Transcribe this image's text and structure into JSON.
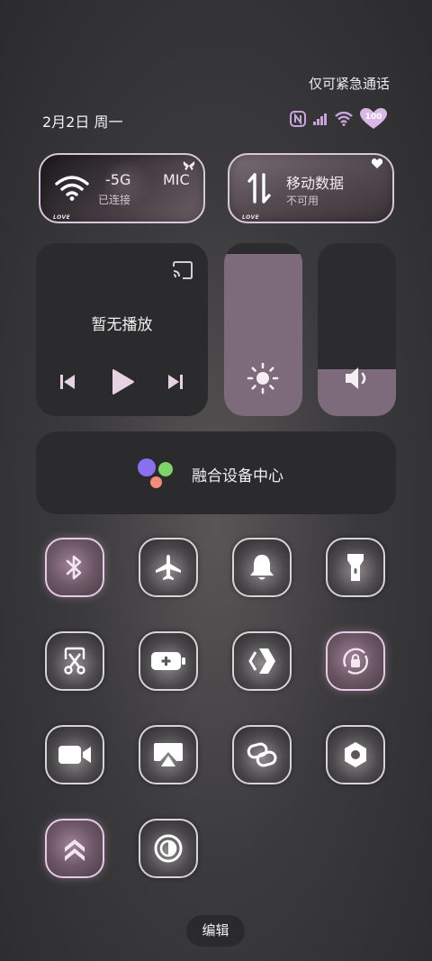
{
  "status": {
    "emergency_text": "仅可紧急通话",
    "date": "2月2日 周一",
    "battery_level": "100"
  },
  "wifi_card": {
    "network_name": "-5G",
    "overlay_text": "MIC",
    "status": "已连接",
    "sticker": "LOVE"
  },
  "mobile_data_card": {
    "title": "移动数据",
    "status": "不可用",
    "sticker": "LOVE"
  },
  "media": {
    "title": "暂无播放"
  },
  "brightness": {
    "level": 0.94
  },
  "volume": {
    "level": 0.27
  },
  "fusion": {
    "label": "融合设备中心",
    "dot_colors": [
      "#8a6ff0",
      "#7ed36a",
      "#f38b7a"
    ]
  },
  "tiles": [
    {
      "name": "bluetooth",
      "active": true
    },
    {
      "name": "airplane-mode",
      "active": false
    },
    {
      "name": "sound",
      "active": false
    },
    {
      "name": "flashlight",
      "active": false
    },
    {
      "name": "screenshot",
      "active": false
    },
    {
      "name": "battery-saver",
      "active": false
    },
    {
      "name": "nfc-share",
      "active": false
    },
    {
      "name": "auto-rotate",
      "active": true
    },
    {
      "name": "screen-record",
      "active": false
    },
    {
      "name": "screen-cast",
      "active": false
    },
    {
      "name": "link",
      "active": false
    },
    {
      "name": "settings",
      "active": false
    },
    {
      "name": "priority-mode",
      "active": true
    },
    {
      "name": "dark-mode",
      "active": false
    }
  ],
  "edit_label": "编辑"
}
